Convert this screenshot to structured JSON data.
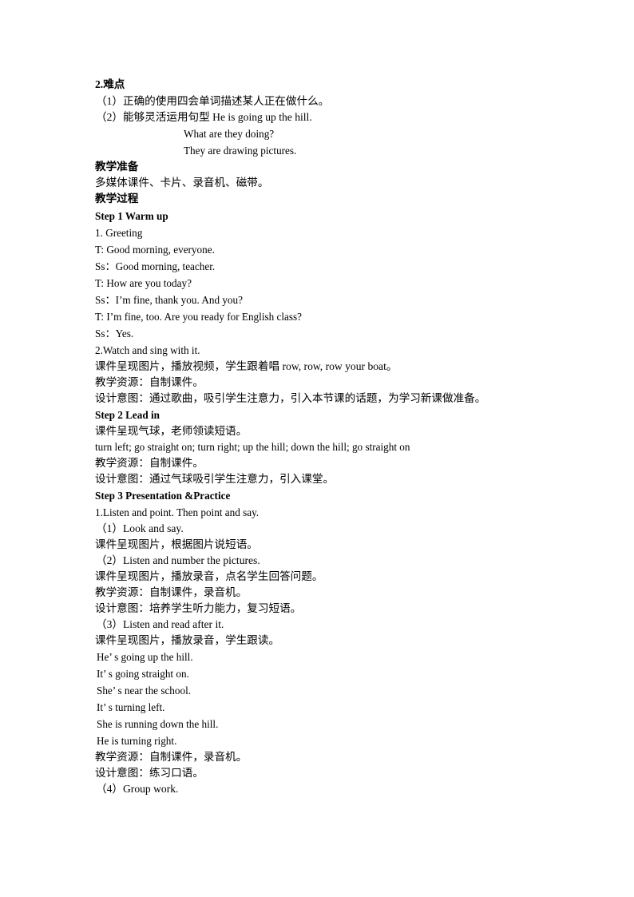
{
  "document": {
    "kind": "lesson-plan",
    "language": "zh-CN/en",
    "page_background": "#ffffff",
    "text_color": "#000000"
  },
  "sections": {
    "difficulty": {
      "heading": "2.难点",
      "item1": "（1）正确的使用四会单词描述某人正在做什么。",
      "item2_prefix": "（2）能够灵活运用句型 He is going up the hill.",
      "item2_line2": "What are they doing?",
      "item2_line3": "They are drawing pictures."
    },
    "preparation": {
      "heading": "教学准备",
      "body": "多媒体课件、卡片、录音机、磁带。"
    },
    "process": {
      "heading": "教学过程"
    },
    "step1": {
      "heading": "Step 1 Warm up",
      "lines": [
        "1. Greeting",
        "T: Good morning, everyone.",
        "Ss：Good morning, teacher.",
        "T: How are you today?",
        "Ss：I’m fine, thank you. And you?",
        "T: I’m fine, too. Are you ready for English class?",
        "Ss：Yes.",
        "2.Watch and sing with it."
      ],
      "cn_lines": [
        "课件呈现图片，播放视频，学生跟着唱 row, row, row your boat。",
        "教学资源：自制课件。",
        "设计意图：通过歌曲，吸引学生注意力，引入本节课的话题，为学习新课做准备。"
      ]
    },
    "step2": {
      "heading": "Step 2 Lead in",
      "cn_line1": "课件呈现气球，老师领读短语。",
      "en_phrases": "turn left; go straight on; turn right; up the hill; down the hill; go straight on",
      "cn_line2": "教学资源：自制课件。",
      "cn_line3": "设计意图：通过气球吸引学生注意力，引入课堂。"
    },
    "step3": {
      "heading": "Step 3 Presentation &Practice",
      "lead": "1.Listen and point. Then point and say.",
      "sub1": {
        "title": "（1）Look and say.",
        "cn": "课件呈现图片，根据图片说短语。"
      },
      "sub2": {
        "title": "（2）Listen and number the pictures.",
        "cn1": "课件呈现图片，播放录音，点名学生回答问题。",
        "cn2": "教学资源：自制课件，录音机。",
        "cn3": "设计意图：培养学生听力能力，复习短语。"
      },
      "sub3": {
        "title": "（3）Listen and read after it.",
        "cn1": "课件呈现图片，播放录音，学生跟读。",
        "sentences": [
          "He’ s going up the hill.",
          "It’ s going straight on.",
          "She’ s near the school.",
          "It’ s turning left.",
          "She is running down the hill.",
          "He is turning right."
        ],
        "cn2": "教学资源：自制课件，录音机。",
        "cn3": "设计意图：练习口语。"
      },
      "sub4": {
        "title": "（4）Group work."
      }
    }
  }
}
